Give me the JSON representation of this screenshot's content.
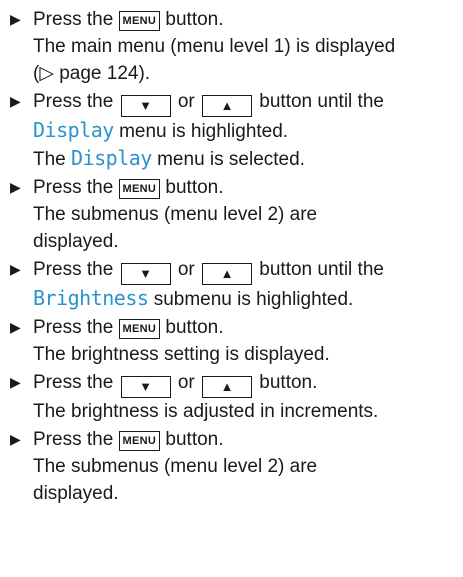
{
  "bullet_glyph": "▶",
  "keys": {
    "menu": "MENU",
    "down": "▼",
    "up": "▲"
  },
  "highlight_color": "#2a93c9",
  "steps": [
    {
      "pre": "Press the",
      "post": "button.",
      "result_1": "The main menu (menu level 1) is displayed",
      "result_2": "(▷ page 124)."
    },
    {
      "pre": "Press the",
      "or": "or",
      "post": "button until the",
      "hl": "Display",
      "line2_post": "menu is highlighted.",
      "result_pre": "The",
      "result_hl": "Display",
      "result_post": "menu is selected."
    },
    {
      "pre": "Press the",
      "post": "button.",
      "result_1": "The submenus (menu level 2) are",
      "result_2": "displayed."
    },
    {
      "pre": "Press the",
      "or": "or",
      "post": "button until the",
      "hl": "Brightness",
      "line2_post": "submenu is highlighted."
    },
    {
      "pre": "Press the",
      "post": "button.",
      "result_1": "The brightness setting is displayed."
    },
    {
      "pre": "Press the",
      "or": "or",
      "post": "button.",
      "result_1": "The brightness is adjusted in increments."
    },
    {
      "pre": "Press the",
      "post": "button.",
      "result_1": "The submenus (menu level 2) are",
      "result_2": "displayed."
    }
  ]
}
